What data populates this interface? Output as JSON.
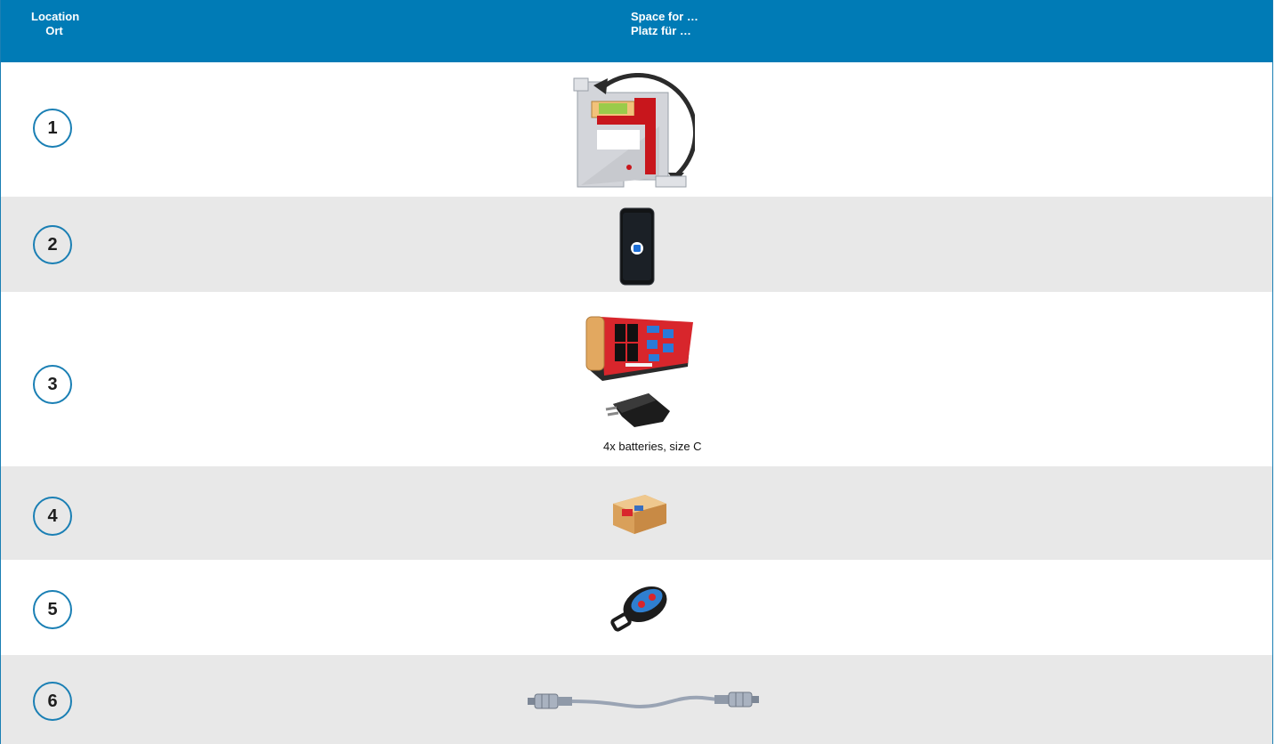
{
  "header": {
    "location_en": "Location",
    "location_de": "Ort",
    "space_en": "Space for …",
    "space_de": "Platz für …"
  },
  "rows": [
    {
      "number": "1",
      "item_icon": "angle-measuring-device-icon"
    },
    {
      "number": "2",
      "item_icon": "smartphone-icon"
    },
    {
      "number": "3",
      "item_icon": "control-unit-icon",
      "extra_icon": "power-adapter-icon",
      "caption": "4x batteries, size C"
    },
    {
      "number": "4",
      "item_icon": "receiver-box-icon"
    },
    {
      "number": "5",
      "item_icon": "remote-key-fob-icon"
    },
    {
      "number": "6",
      "item_icon": "connection-cable-icon"
    }
  ],
  "colors": {
    "header_bg": "#007bb6",
    "border": "#1a7fb4",
    "row_grey": "#e8e8e8"
  }
}
